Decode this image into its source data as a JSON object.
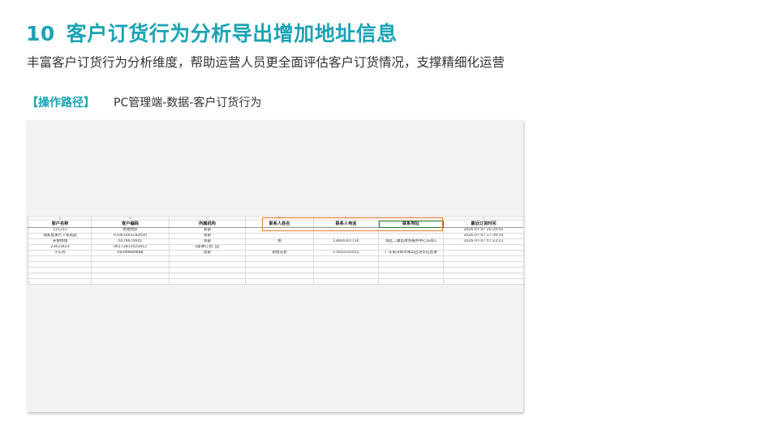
{
  "slide": {
    "number": "10",
    "title": "客户订货行为分析导出增加地址信息",
    "subtitle": "丰富客户订货行为分析维度，帮助运营人员更全面评估客户订货情况，支撑精细化运营",
    "path_label": "【操作路径】",
    "path_value": "PC管理端-数据-客户订货行为"
  },
  "colors": {
    "accent": "#1aa3b4",
    "highlight": "#f07a2a"
  },
  "spreadsheet": {
    "column_letters": [
      "A",
      "B",
      "C",
      "D",
      "E",
      "F",
      "G"
    ],
    "headers": [
      "客户名称",
      "客户编码",
      "所属机构",
      "联系人姓名",
      "联系人电话",
      "联系地址",
      "最近订货时间"
    ],
    "rows": [
      [
        "121212",
        "哈哈哈好",
        "总部",
        "",
        "",
        "",
        "2026-07-07 20:24:01"
      ],
      [
        "商家直发代下单商品",
        "07061003182650",
        "总部",
        "",
        "",
        "",
        "2026-07-07 17:39:54"
      ],
      [
        "长春杨旭",
        "6579674641",
        "总部",
        "杨",
        "13664307710",
        "浦区二康区政务服务中心东南1",
        "2026-07-07 07:23:21"
      ],
      [
        "23423423",
        "06171813425812",
        "a基事订货门店",
        "",
        "",
        "",
        ""
      ],
      [
        "小心点",
        "08399889888",
        "总部",
        "谢谢兄弟",
        "17655555555",
        "广东省深圳市南山区湾华信息港",
        ""
      ]
    ]
  }
}
